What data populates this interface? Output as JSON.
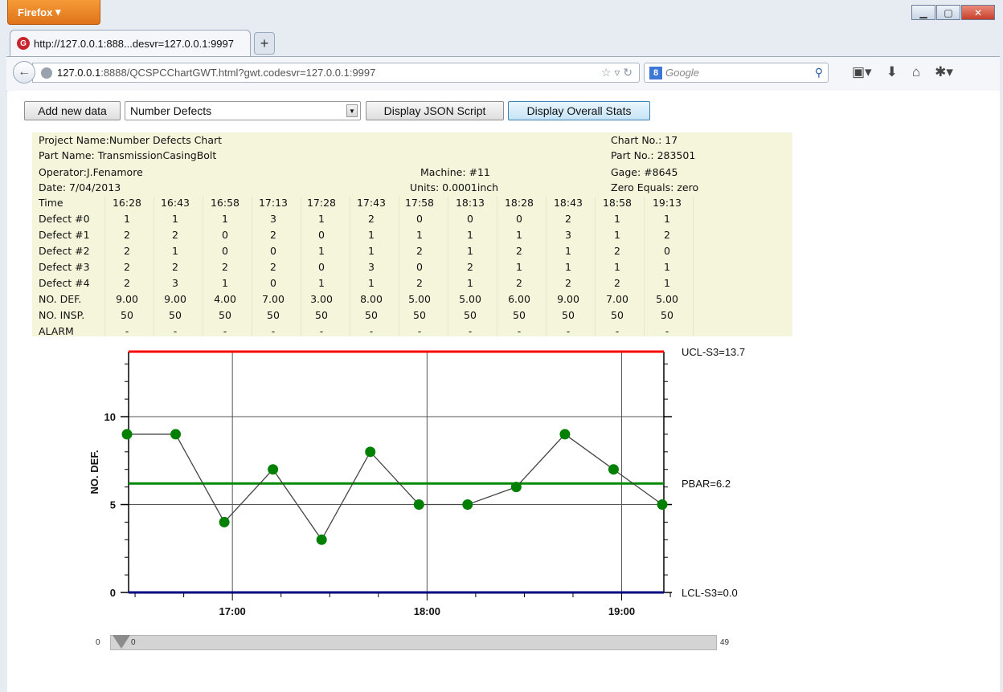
{
  "browser": {
    "menu_label": "Firefox",
    "tab_title": "http://127.0.0.1:888...desvr=127.0.0.1:9997",
    "url_host": "127.0.0.1",
    "url_rest": ":8888/QCSPCChartGWT.html?gwt.codesvr=127.0.0.1:9997",
    "search_placeholder": "Google"
  },
  "toolbar": {
    "add_label": "Add new data",
    "select_value": "Number Defects",
    "json_label": "Display JSON Script",
    "stats_label": "Display Overall Stats"
  },
  "header": {
    "project": "Project Name:Number Defects Chart",
    "part_name": "Part Name: TransmissionCasingBolt",
    "operator": "Operator:J.Fenamore",
    "date": "Date: 7/04/2013",
    "machine": "Machine: #11",
    "units": "Units: 0.0001inch",
    "chart_no": "Chart No.: 17",
    "part_no": "Part No.: 283501",
    "gage": "Gage: #8645",
    "zero": "Zero Equals: zero"
  },
  "table": {
    "rows": [
      {
        "label": "Time",
        "cells": [
          "16:28",
          "16:43",
          "16:58",
          "17:13",
          "17:28",
          "17:43",
          "17:58",
          "18:13",
          "18:28",
          "18:43",
          "18:58",
          "19:13"
        ]
      },
      {
        "label": "Defect #0",
        "cells": [
          "1",
          "1",
          "1",
          "3",
          "1",
          "2",
          "0",
          "0",
          "0",
          "2",
          "1",
          "1"
        ]
      },
      {
        "label": "Defect #1",
        "cells": [
          "2",
          "2",
          "0",
          "2",
          "0",
          "1",
          "1",
          "1",
          "1",
          "3",
          "1",
          "2"
        ]
      },
      {
        "label": "Defect #2",
        "cells": [
          "2",
          "1",
          "0",
          "0",
          "1",
          "1",
          "2",
          "1",
          "2",
          "1",
          "2",
          "0"
        ]
      },
      {
        "label": "Defect #3",
        "cells": [
          "2",
          "2",
          "2",
          "2",
          "0",
          "3",
          "0",
          "2",
          "1",
          "1",
          "1",
          "1"
        ]
      },
      {
        "label": "Defect #4",
        "cells": [
          "2",
          "3",
          "1",
          "0",
          "1",
          "1",
          "2",
          "1",
          "2",
          "2",
          "2",
          "1"
        ]
      },
      {
        "label": "NO. DEF.",
        "cells": [
          "9.00",
          "9.00",
          "4.00",
          "7.00",
          "3.00",
          "8.00",
          "5.00",
          "5.00",
          "6.00",
          "9.00",
          "7.00",
          "5.00"
        ]
      },
      {
        "label": "NO. INSP.",
        "cells": [
          "50",
          "50",
          "50",
          "50",
          "50",
          "50",
          "50",
          "50",
          "50",
          "50",
          "50",
          "50"
        ]
      },
      {
        "label": "ALARM",
        "cells": [
          "-",
          "-",
          "-",
          "-",
          "-",
          "-",
          "-",
          "-",
          "-",
          "-",
          "-",
          "-"
        ]
      }
    ]
  },
  "chart_data": {
    "type": "line",
    "ylabel": "NO. DEF.",
    "ylim": [
      0,
      13.7
    ],
    "yticks": [
      "0",
      "5",
      "10"
    ],
    "xticks": [
      "17:00",
      "18:00",
      "19:00"
    ],
    "x": [
      "16:28",
      "16:43",
      "16:58",
      "17:13",
      "17:28",
      "17:43",
      "17:58",
      "18:13",
      "18:28",
      "18:43",
      "18:58",
      "19:13"
    ],
    "series": [
      {
        "values": [
          9,
          9,
          4,
          7,
          3,
          8,
          5,
          5,
          6,
          9,
          7,
          5
        ]
      }
    ],
    "limits": {
      "ucl": 13.7,
      "center": 6.2,
      "lcl": 0.0
    },
    "limit_labels": {
      "ucl": "UCL-S3=13.7",
      "center": "PBAR=6.2",
      "lcl": "LCL-S3=0.0"
    },
    "colors": {
      "ucl": "#ff0000",
      "center": "#008800",
      "lcl": "#000080",
      "points": "#008000"
    }
  },
  "scrollbar": {
    "min_label": "0",
    "thumb_label": "0",
    "max_label": "49",
    "position": 0
  }
}
